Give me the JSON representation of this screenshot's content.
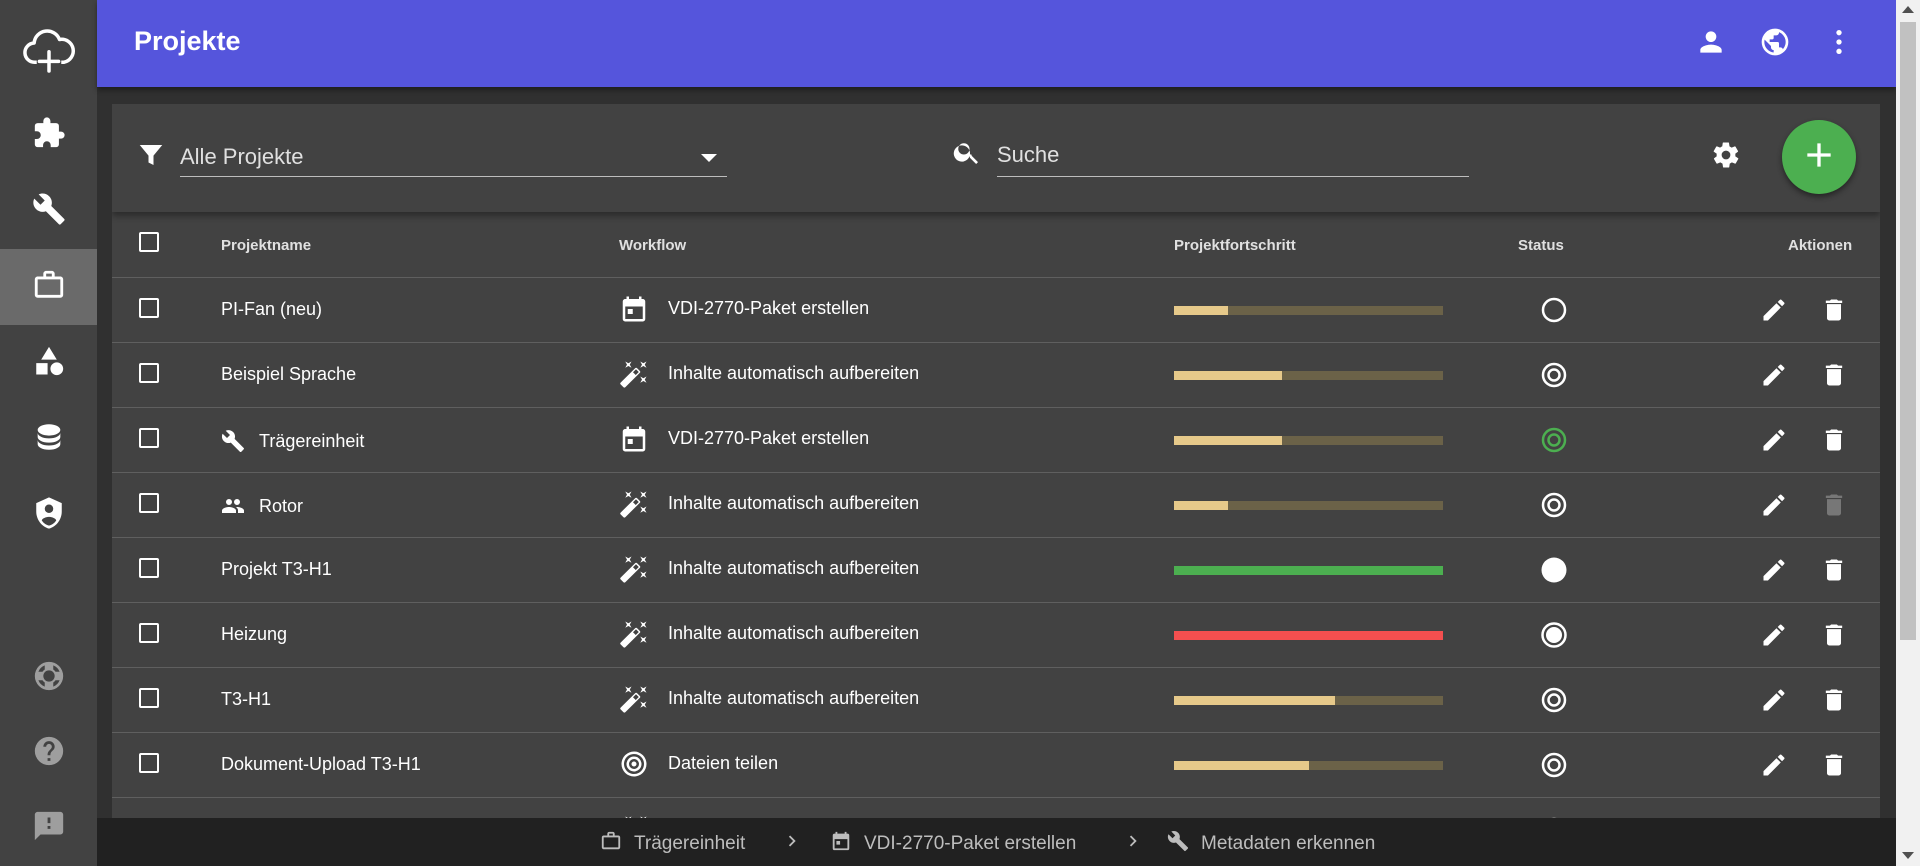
{
  "header": {
    "title": "Projekte"
  },
  "sidebar": {
    "items": [
      {
        "name": "cloud-add-icon"
      },
      {
        "name": "puzzle-icon"
      },
      {
        "name": "wrench-icon"
      },
      {
        "name": "briefcase-icon",
        "active": true
      },
      {
        "name": "shapes-icon"
      },
      {
        "name": "database-icon"
      },
      {
        "name": "shield-account-icon"
      },
      {
        "name": "lifebuoy-icon"
      },
      {
        "name": "help-icon"
      },
      {
        "name": "feedback-icon"
      }
    ]
  },
  "toolbar": {
    "filter_value": "Alle Projekte",
    "search_placeholder": "Suche"
  },
  "table": {
    "columns": {
      "name": "Projektname",
      "workflow": "Workflow",
      "progress": "Projektfortschritt",
      "status": "Status",
      "actions": "Aktionen"
    },
    "rows": [
      {
        "name": "PI-Fan (neu)",
        "name_icon": "",
        "workflow": "VDI-2770-Paket erstellen",
        "workflow_icon": "package-icon",
        "progress": 0.2,
        "progress_color": "#e6c98a",
        "status": "circle-outline"
      },
      {
        "name": "Beispiel Sprache",
        "name_icon": "",
        "workflow": "Inhalte automatisch aufbereiten",
        "workflow_icon": "magic-wand-icon",
        "progress": 0.4,
        "progress_color": "#e6c98a",
        "status": "target"
      },
      {
        "name": "Trägereinheit",
        "name_icon": "wrench-icon",
        "workflow": "VDI-2770-Paket erstellen",
        "workflow_icon": "package-icon",
        "progress": 0.4,
        "progress_color": "#e6c98a",
        "status": "target-green"
      },
      {
        "name": "Rotor",
        "name_icon": "account-group-icon",
        "workflow": "Inhalte automatisch aufbereiten",
        "workflow_icon": "magic-wand-icon",
        "progress": 0.2,
        "progress_color": "#e6c98a",
        "status": "target",
        "delete_disabled": true
      },
      {
        "name": "Projekt T3-H1",
        "name_icon": "",
        "workflow": "Inhalte automatisch aufbereiten",
        "workflow_icon": "magic-wand-icon",
        "progress": 1.0,
        "progress_color": "#4caf50",
        "status": "filled"
      },
      {
        "name": "Heizung",
        "name_icon": "",
        "workflow": "Inhalte automatisch aufbereiten",
        "workflow_icon": "magic-wand-icon",
        "progress": 1.0,
        "progress_color": "#f44f4f",
        "status": "filled-ring"
      },
      {
        "name": "T3-H1",
        "name_icon": "",
        "workflow": "Inhalte automatisch aufbereiten",
        "workflow_icon": "magic-wand-icon",
        "progress": 0.6,
        "progress_color": "#e6c98a",
        "status": "target"
      },
      {
        "name": "Dokument-Upload T3-H1",
        "name_icon": "",
        "workflow": "Dateien teilen",
        "workflow_icon": "target-icon",
        "progress": 0.5,
        "progress_color": "#e6c98a",
        "status": "target"
      },
      {
        "name": "",
        "name_icon": "",
        "workflow": "",
        "workflow_icon": "magic-wand-icon",
        "progress": 0.0,
        "progress_color": "#e6c98a",
        "status": "circle-outline"
      }
    ]
  },
  "breadcrumb": {
    "items": [
      {
        "label": "Trägereinheit",
        "icon": "briefcase-icon"
      },
      {
        "label": "VDI-2770-Paket erstellen",
        "icon": "package-icon"
      },
      {
        "label": "Metadaten erkennen",
        "icon": "wrench-icon"
      }
    ]
  },
  "colors": {
    "accent": "#5555dc",
    "primary_action": "#4caf50",
    "progress_track": "#6b6248",
    "progress_fill": "#e6c98a",
    "error": "#f44f4f"
  }
}
